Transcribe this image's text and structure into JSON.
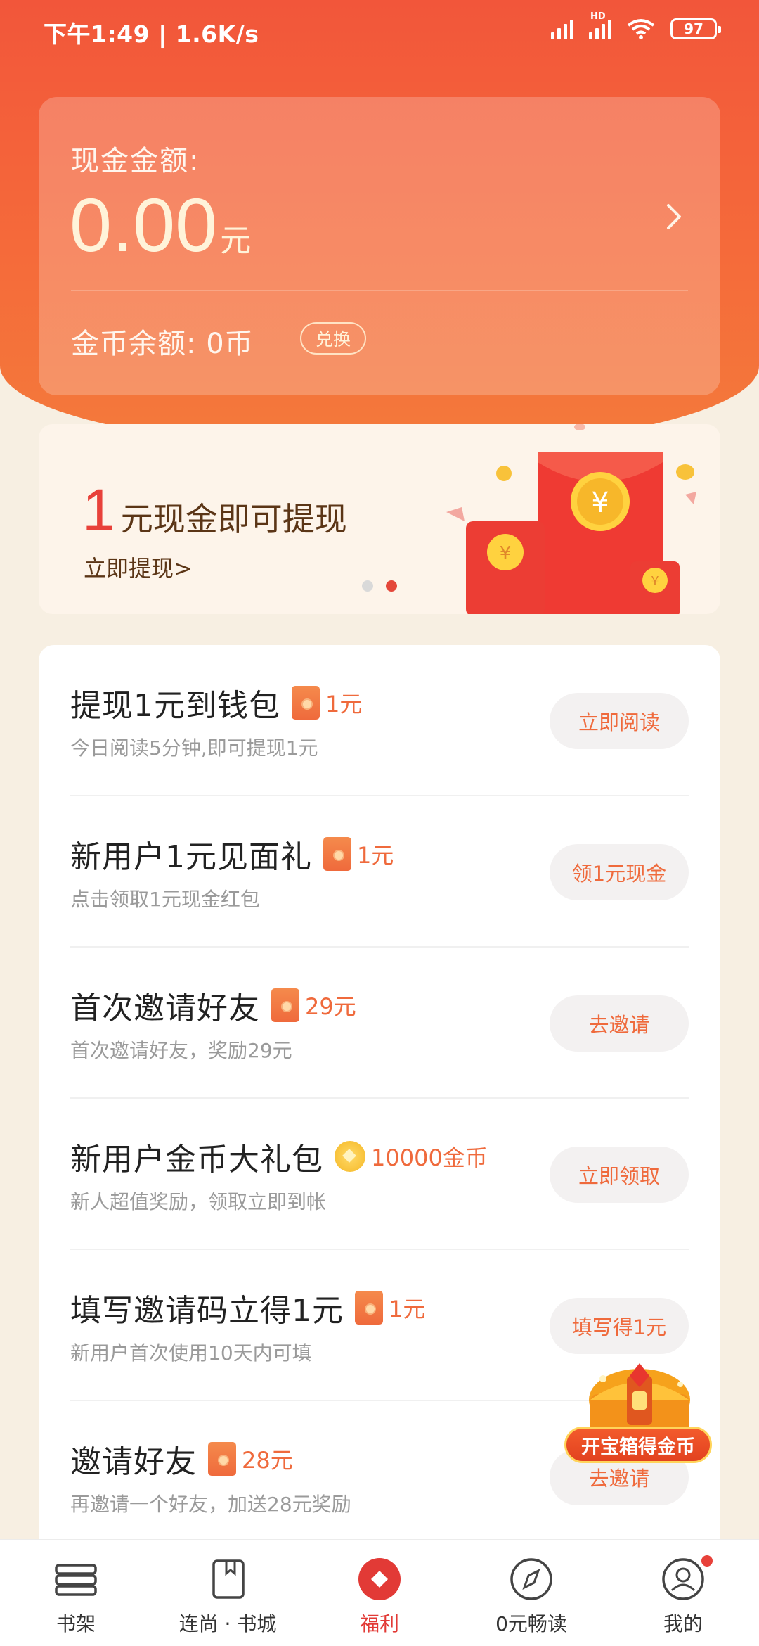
{
  "status_bar": {
    "time": "下午1:49 | 1.6K/s",
    "battery": "97",
    "hd_label": "HD"
  },
  "cash": {
    "label": "现金金额:",
    "amount": "0.00",
    "unit": "元",
    "coin_balance": "金币余额: 0币",
    "exchange_label": "兑换"
  },
  "banner": {
    "number": "1",
    "text": "元现金即可提现",
    "link": "立即提现>",
    "pages": 2,
    "active_page": 2
  },
  "tasks": [
    {
      "title": "提现1元到钱包",
      "reward": "1元",
      "reward_type": "red-envelope",
      "subtitle": "今日阅读5分钟,即可提现1元",
      "button": "立即阅读"
    },
    {
      "title": "新用户1元见面礼",
      "reward": "1元",
      "reward_type": "red-envelope",
      "subtitle": "点击领取1元现金红包",
      "button": "领1元现金"
    },
    {
      "title": "首次邀请好友",
      "reward": "29元",
      "reward_type": "red-envelope",
      "subtitle": "首次邀请好友，奖励29元",
      "button": "去邀请"
    },
    {
      "title": "新用户金币大礼包",
      "reward": "10000金币",
      "reward_type": "coin",
      "subtitle": "新人超值奖励，领取立即到帐",
      "button": "立即领取"
    },
    {
      "title": "填写邀请码立得1元",
      "reward": "1元",
      "reward_type": "red-envelope",
      "subtitle": "新用户首次使用10天内可填",
      "button": "填写得1元"
    },
    {
      "title": "邀请好友",
      "reward": "28元",
      "reward_type": "red-envelope",
      "subtitle": "再邀请一个好友，加送28元奖励",
      "button": "去邀请"
    }
  ],
  "treasure": {
    "label": "开宝箱得金币"
  },
  "nav": [
    {
      "label": "书架",
      "icon": "bookshelf-icon"
    },
    {
      "label": "连尚 · 书城",
      "icon": "bookstore-icon"
    },
    {
      "label": "福利",
      "icon": "welfare-icon",
      "active": true
    },
    {
      "label": "0元畅读",
      "icon": "compass-icon"
    },
    {
      "label": "我的",
      "icon": "profile-icon",
      "badge": true
    }
  ],
  "colors": {
    "accent": "#f2563a",
    "reward_orange": "#ef6a3c",
    "active_nav": "#e23a36"
  }
}
